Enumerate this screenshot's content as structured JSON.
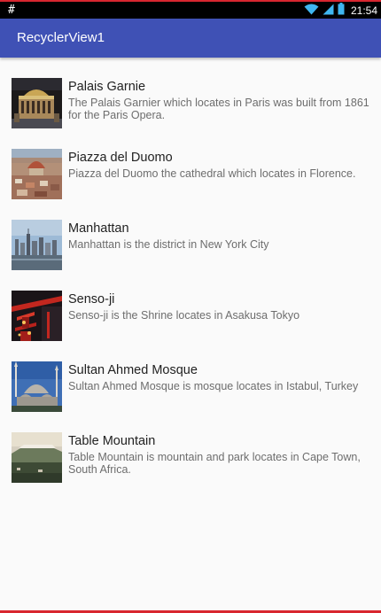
{
  "statusbar": {
    "left_glyph": "#",
    "time": "21:54",
    "icons": [
      "wifi-icon",
      "signal-icon",
      "battery-icon"
    ]
  },
  "appbar": {
    "title": "RecyclerView1",
    "color": "#3f51b5"
  },
  "items": [
    {
      "title": "Palais Garnie",
      "description": "The Palais Garnier which locates in Paris was built from 1861 for the Paris Opera.",
      "image": "palais-garnier-photo"
    },
    {
      "title": "Piazza del Duomo",
      "description": "Piazza del Duomo the cathedral which locates in Florence.",
      "image": "piazza-del-duomo-photo"
    },
    {
      "title": "Manhattan",
      "description": "Manhattan is the district in New York City",
      "image": "manhattan-photo"
    },
    {
      "title": "Senso-ji",
      "description": "Senso-ji is the Shrine locates in Asakusa Tokyo",
      "image": "senso-ji-photo"
    },
    {
      "title": "Sultan Ahmed Mosque",
      "description": "Sultan Ahmed Mosque is mosque locates in Istabul, Turkey",
      "image": "sultan-ahmed-mosque-photo"
    },
    {
      "title": "Table Mountain",
      "description": "Table Mountain is mountain and park locates in Cape Town, South Africa.",
      "image": "table-mountain-photo"
    }
  ]
}
